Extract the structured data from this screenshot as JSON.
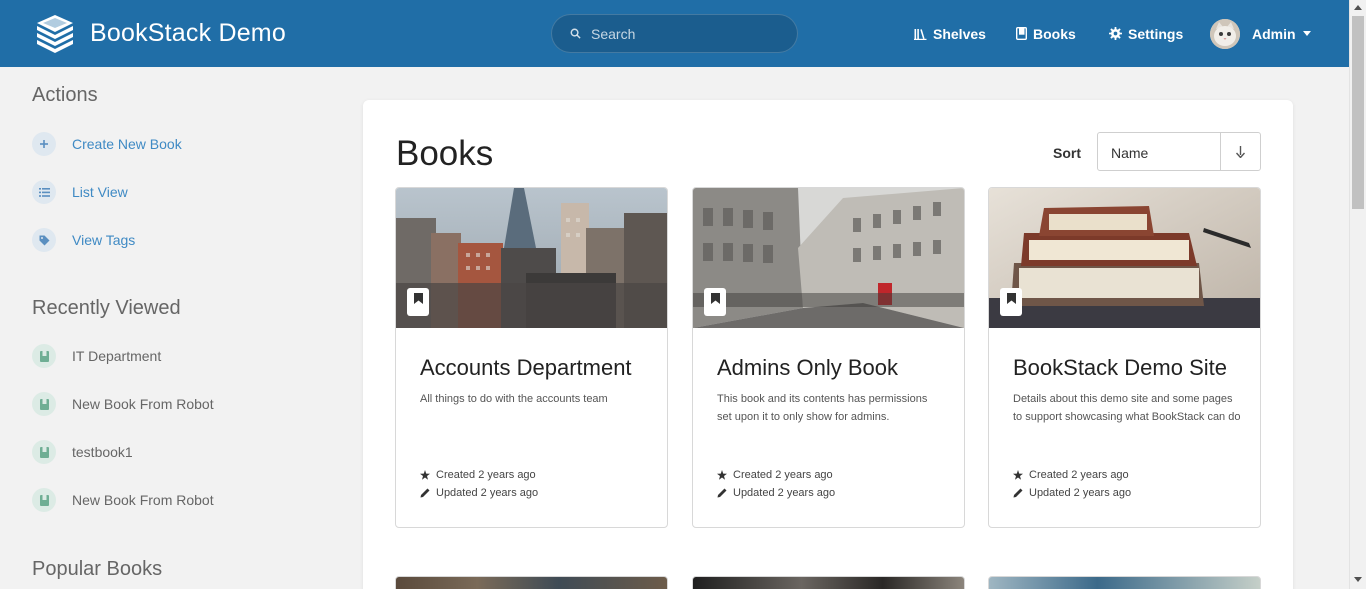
{
  "header": {
    "app_title": "BookStack Demo",
    "search_placeholder": "Search",
    "nav": [
      {
        "label": "Shelves",
        "icon": "shelves-icon"
      },
      {
        "label": "Books",
        "icon": "book-icon"
      },
      {
        "label": "Settings",
        "icon": "gear-icon"
      }
    ],
    "user": {
      "name": "Admin"
    },
    "brand_color": "#206ea7"
  },
  "sidebar": {
    "actions": {
      "heading": "Actions",
      "items": [
        {
          "label": "Create New Book",
          "icon": "plus-icon"
        },
        {
          "label": "List View",
          "icon": "list-icon"
        },
        {
          "label": "View Tags",
          "icon": "tag-icon"
        }
      ]
    },
    "recently_viewed": {
      "heading": "Recently Viewed",
      "items": [
        {
          "label": "IT Department",
          "icon": "book-icon"
        },
        {
          "label": "New Book From Robot",
          "icon": "book-icon"
        },
        {
          "label": "testbook1",
          "icon": "book-icon"
        },
        {
          "label": "New Book From Robot",
          "icon": "book-icon"
        }
      ]
    },
    "popular": {
      "heading": "Popular Books"
    }
  },
  "main": {
    "title": "Books",
    "sort": {
      "label": "Sort",
      "selected": "Name",
      "direction_icon": "arrow-down-icon"
    },
    "books": [
      {
        "title": "Accounts Department",
        "description": "All things to do with the accounts team",
        "created": "Created 2 years ago",
        "updated": "Updated 2 years ago",
        "cover": "city-skyline-photo"
      },
      {
        "title": "Admins Only Book",
        "description": "This book and its contents has permissions set upon it to only show for admins.",
        "created": "Created 2 years ago",
        "updated": "Updated 2 years ago",
        "cover": "street-buildings-photo"
      },
      {
        "title": "BookStack Demo Site",
        "description": "Details about this demo site and some pages to support showcasing what BookStack can do",
        "created": "Created 2 years ago",
        "updated": "Updated 2 years ago",
        "cover": "stacked-books-photo"
      }
    ]
  }
}
